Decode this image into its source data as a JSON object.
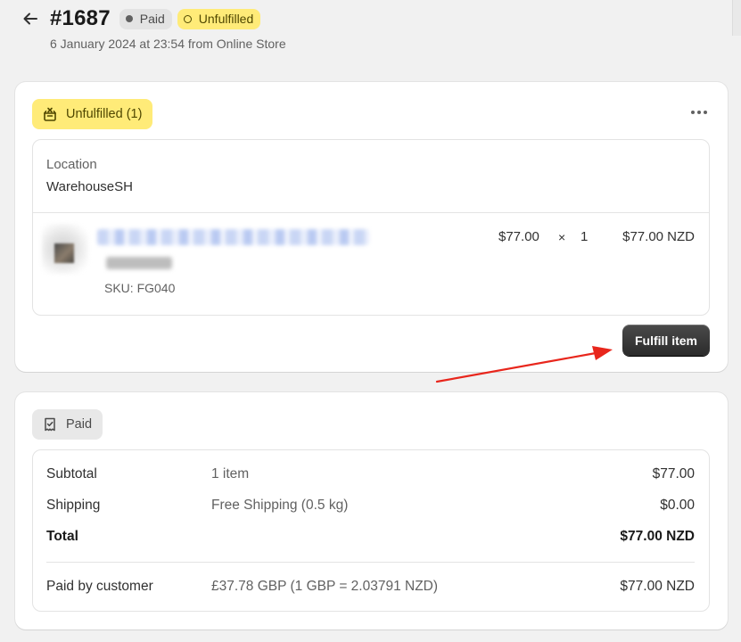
{
  "header": {
    "order_number": "#1687",
    "payment_badge": "Paid",
    "fulfillment_badge": "Unfulfilled",
    "subtitle": "6 January 2024 at 23:54 from Online Store"
  },
  "fulfillment_card": {
    "status_label": "Unfulfilled (1)",
    "location_label": "Location",
    "location_value": "WarehouseSH",
    "line_item": {
      "sku_label": "SKU:",
      "sku_value": "FG040",
      "unit_price": "$77.00",
      "times": "×",
      "quantity": "1",
      "total": "$77.00 NZD"
    },
    "fulfill_button": "Fulfill item"
  },
  "payment_card": {
    "status_label": "Paid",
    "rows": [
      {
        "label": "Subtotal",
        "detail": "1 item",
        "amount": "$77.00"
      },
      {
        "label": "Shipping",
        "detail": "Free Shipping (0.5 kg)",
        "amount": "$0.00"
      },
      {
        "label": "Total",
        "detail": "",
        "amount": "$77.00 NZD"
      }
    ],
    "paid_by": {
      "label": "Paid by customer",
      "detail": "£37.78 GBP (1 GBP = 2.03791 NZD)",
      "amount": "$77.00 NZD"
    }
  },
  "colors": {
    "unfulfilled_yellow": "#ffeb78",
    "button_dark": "#303030",
    "annotation_arrow": "#e8261c"
  },
  "icons": [
    "back-arrow-icon",
    "status-dot-icon",
    "unfulfilled-ring-icon",
    "unfulfilled-box-icon",
    "more-horizontal-icon",
    "receipt-icon",
    "annotation-arrow"
  ]
}
